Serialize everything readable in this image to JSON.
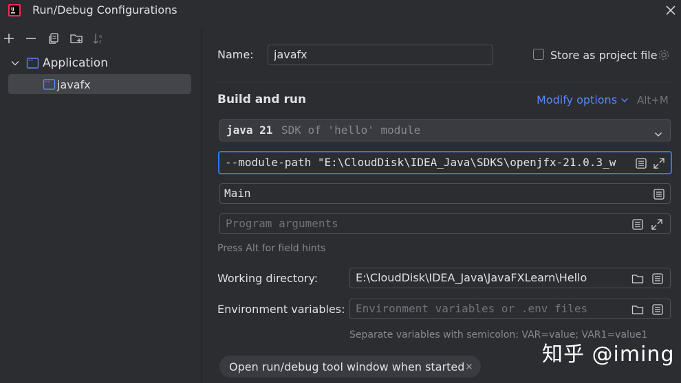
{
  "window": {
    "title": "Run/Debug Configurations"
  },
  "tree": {
    "group_label": "Application",
    "item_label": "javafx"
  },
  "name_field": {
    "label": "Name:",
    "value": "javafx"
  },
  "store_project": {
    "label": "Store as project file"
  },
  "build_run": {
    "heading": "Build and run",
    "modify_options": "Modify options",
    "shortcut": "Alt+M",
    "jdk_main": "java 21",
    "jdk_detail": "SDK of 'hello' module",
    "vm_options": "--module-path \"E:\\CloudDisk\\IDEA_Java\\SDKS\\openjfx-21.0.3_w",
    "main_class": "Main",
    "program_args_placeholder": "Program arguments",
    "field_hint": "Press Alt for field hints"
  },
  "working_dir": {
    "label": "Working directory:",
    "value": "E:\\CloudDisk\\IDEA_Java\\JavaFXLearn\\Hello"
  },
  "env_vars": {
    "label": "Environment variables:",
    "placeholder": "Environment variables or .env files",
    "hint": "Separate variables with semicolon: VAR=value; VAR1=value1"
  },
  "chip": {
    "label": "Open run/debug tool window when started"
  },
  "watermark": "知乎 @iming",
  "colors": {
    "accent": "#548af7",
    "focus_border": "#3574f0",
    "background": "#2b2d30"
  }
}
